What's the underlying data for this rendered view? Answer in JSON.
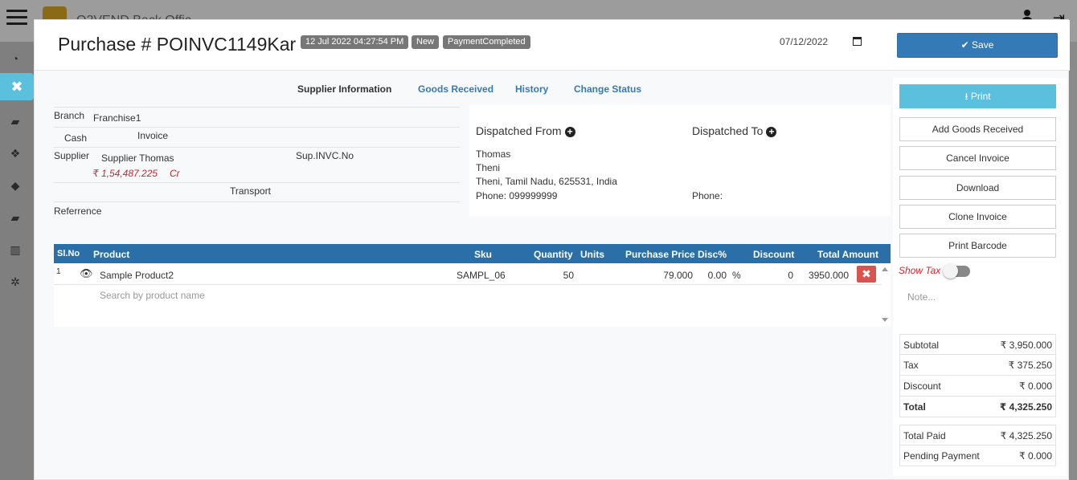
{
  "app": {
    "brand": "O2VEND Back Offic"
  },
  "sidebar": {
    "close_icon": "✖"
  },
  "header": {
    "title": "Purchase # POINVC1149Kar",
    "timestamp_badge": "12 Jul 2022 04:27:54 PM",
    "status_badge": "New",
    "payment_badge": "PaymentCompleted",
    "date_value": "07/12/2022",
    "save_label": "Save"
  },
  "tabs": [
    {
      "label": "Supplier Information"
    },
    {
      "label": "Goods Received"
    },
    {
      "label": "History"
    },
    {
      "label": "Change Status"
    }
  ],
  "supplier_form": {
    "branch_label": "Branch",
    "branch_value": "Franchise1",
    "payment_type": "Cash",
    "invoice_label": "Invoice",
    "supplier_label": "Supplier",
    "supplier_value": "Supplier Thomas",
    "balance": "₹ 1,54,487.225",
    "balance_type": "Cr",
    "sup_invc_label": "Sup.INVC.No",
    "transport_label": "Transport",
    "reference_label": "Referrence"
  },
  "dispatch": {
    "from_title": "Dispatched From",
    "to_title": "Dispatched To",
    "from_name": "Thomas",
    "from_city": "Theni",
    "from_address": "Theni, Tamil Nadu, 625531, India",
    "from_phone": "Phone: 099999999",
    "to_phone": "Phone:"
  },
  "products_table": {
    "columns": [
      "Sl.No",
      "Product",
      "Sku",
      "Quantity",
      "Units",
      "Purchase Price",
      "Disc%",
      "Discount",
      "Total Amount"
    ],
    "rows": [
      {
        "sl": "1",
        "product": "Sample Product2",
        "sku": "SAMPL_06",
        "quantity": "50",
        "units": "",
        "price": "79.000",
        "disc_pct": "0.00",
        "pct_symbol": "%",
        "discount": "0",
        "total": "3950.000"
      }
    ],
    "search_placeholder": "Search by product name"
  },
  "actions": {
    "print_label": "Print",
    "add_goods_received": "Add Goods Received",
    "cancel_invoice": "Cancel Invoice",
    "download": "Download",
    "clone_invoice": "Clone Invoice",
    "print_barcode": "Print Barcode",
    "show_tax_label": "Show Tax",
    "note_placeholder": "Note..."
  },
  "summary": {
    "subtotal_label": "Subtotal",
    "subtotal": "₹ 3,950.000",
    "tax_label": "Tax",
    "tax": "₹ 375.250",
    "discount_label": "Discount",
    "discount": "₹ 0.000",
    "total_label": "Total",
    "total": "₹ 4,325.250",
    "total_paid_label": "Total Paid",
    "total_paid": "₹ 4,325.250",
    "pending_label": "Pending Payment",
    "pending": "₹ 0.000"
  },
  "colors": {
    "primary": "#337ab7",
    "info": "#5bc0de",
    "danger": "#d9534f",
    "badge": "#777777",
    "table_header": "#2a6fa8"
  }
}
